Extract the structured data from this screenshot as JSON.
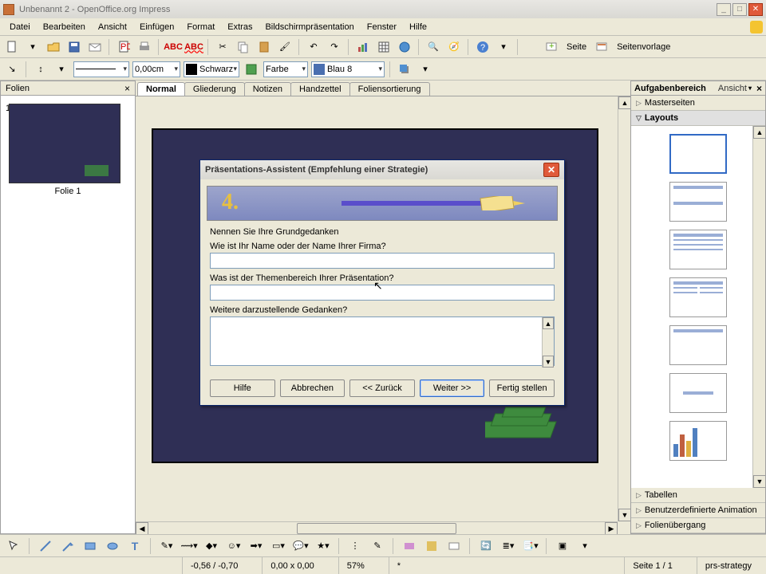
{
  "window": {
    "title": "Unbenannt 2 - OpenOffice.org Impress"
  },
  "menu": {
    "items": [
      "Datei",
      "Bearbeiten",
      "Ansicht",
      "Einfügen",
      "Format",
      "Extras",
      "Bildschirmpräsentation",
      "Fenster",
      "Hilfe"
    ]
  },
  "toolbar2": {
    "width_value": "0,00cm",
    "color_sel": "Schwarz",
    "fill_label": "Farbe",
    "fill_color": "Blau 8"
  },
  "toolbar1_right": {
    "page_label": "Seite",
    "template_label": "Seitenvorlage"
  },
  "slidespanel": {
    "title": "Folien",
    "slide1_caption": "Folie 1",
    "slide1_num": "1"
  },
  "viewtabs": {
    "normal": "Normal",
    "outline": "Gliederung",
    "notes": "Notizen",
    "handout": "Handzettel",
    "sort": "Foliensortierung"
  },
  "taskspanel": {
    "title": "Aufgabenbereich",
    "view": "Ansicht",
    "sections": {
      "master": "Masterseiten",
      "layouts": "Layouts",
      "tables": "Tabellen",
      "anim": "Benutzerdefinierte Animation",
      "trans": "Folienübergang"
    }
  },
  "dialog": {
    "title": "Präsentations-Assistent (Empfehlung einer Strategie)",
    "step": "4.",
    "group": "Nennen Sie Ihre Grundgedanken",
    "q1": "Wie ist Ihr Name oder der Name Ihrer Firma?",
    "q2": "Was ist der Themenbereich Ihrer Präsentation?",
    "q3": "Weitere darzustellende Gedanken?",
    "btn_help": "Hilfe",
    "btn_cancel": "Abbrechen",
    "btn_back": "<< Zurück",
    "btn_next": "Weiter >>",
    "btn_finish": "Fertig stellen"
  },
  "status": {
    "coords": "-0,56 / -0,70",
    "size": "0,00 x 0,00",
    "zoom": "57%",
    "star": "*",
    "page": "Seite 1 / 1",
    "template": "prs-strategy"
  }
}
